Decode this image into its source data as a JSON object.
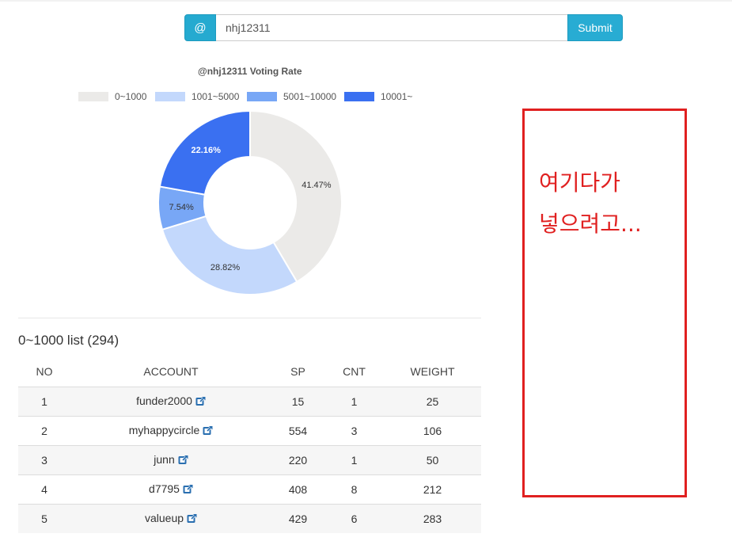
{
  "search": {
    "addon_symbol": "@",
    "value": "nhj12311",
    "submit_label": "Submit"
  },
  "chart_data": {
    "type": "pie",
    "title": "@nhj12311 Voting Rate",
    "legend_placement": "top",
    "categories": [
      "0~1000",
      "1001~5000",
      "5001~10000",
      "10001~"
    ],
    "values": [
      41.47,
      28.82,
      7.54,
      22.16
    ],
    "labels": [
      "41.47%",
      "28.82%",
      "7.54%",
      "22.16%"
    ],
    "colors": [
      "#ebeae8",
      "#c3d8fc",
      "#78a7f6",
      "#3a70f1"
    ],
    "label_colors": [
      "#333333",
      "#333333",
      "#333333",
      "#ffffff"
    ]
  },
  "list": {
    "title": "0~1000 list (294)",
    "columns": [
      "NO",
      "ACCOUNT",
      "SP",
      "CNT",
      "WEIGHT"
    ],
    "rows": [
      {
        "no": "1",
        "account": "funder2000",
        "sp": "15",
        "cnt": "1",
        "weight": "25"
      },
      {
        "no": "2",
        "account": "myhappycircle",
        "sp": "554",
        "cnt": "3",
        "weight": "106"
      },
      {
        "no": "3",
        "account": "junn",
        "sp": "220",
        "cnt": "1",
        "weight": "50"
      },
      {
        "no": "4",
        "account": "d7795",
        "sp": "408",
        "cnt": "8",
        "weight": "212"
      },
      {
        "no": "5",
        "account": "valueup",
        "sp": "429",
        "cnt": "6",
        "weight": "283"
      }
    ],
    "row_icon": "external-link-icon",
    "link_color": "#2a6fb0"
  },
  "annotation": {
    "text": "여기다가\n넣으려고...",
    "color": "#e02020"
  }
}
